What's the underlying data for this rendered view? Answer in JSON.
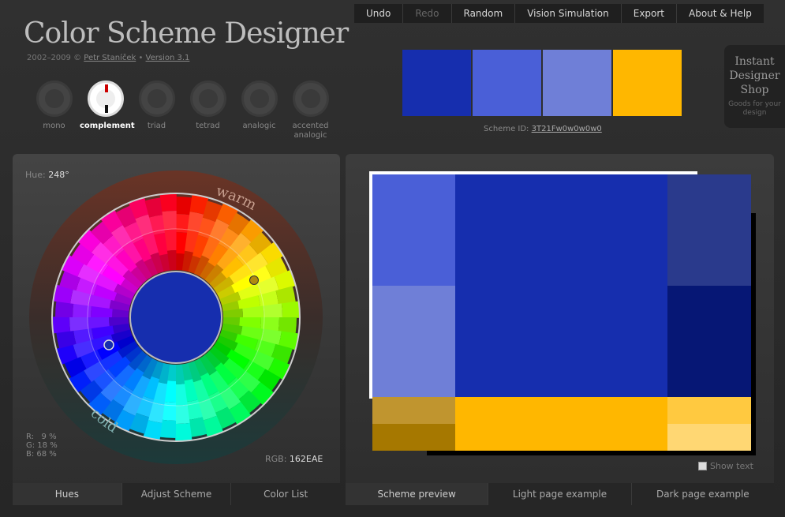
{
  "app": {
    "title": "Color Scheme Designer",
    "credits_prefix": "2002–2009 ©",
    "author": "Petr Staníček",
    "sep": "•",
    "version": "Version 3.1"
  },
  "menu": [
    "Undo",
    "Redo",
    "Random",
    "Vision Simulation",
    "Export",
    "About & Help"
  ],
  "shop": {
    "title": "Instant Designer Shop",
    "sub": "Goods for your design"
  },
  "modes": [
    {
      "label": "mono",
      "active": false
    },
    {
      "label": "complement",
      "active": true
    },
    {
      "label": "triad",
      "active": false
    },
    {
      "label": "tetrad",
      "active": false
    },
    {
      "label": "analogic",
      "active": false
    },
    {
      "label": "accented analogic",
      "active": false
    }
  ],
  "swatches": [
    "#162EAE",
    "#4A5FD7",
    "#6F7FD7",
    "#FFB700"
  ],
  "scheme_id": {
    "label": "Scheme ID:",
    "value": "3T21Fw0w0w0w0"
  },
  "hue": {
    "label": "Hue:",
    "value": "248°"
  },
  "rgb_percent": {
    "r": "R:   9 %",
    "g": "G: 18 %",
    "b": "B: 68 %"
  },
  "rgb_hex": {
    "label": "RGB:",
    "value": "162EAE"
  },
  "wheel": {
    "warm": "warm",
    "cold": "cold"
  },
  "left_tabs": [
    "Hues",
    "Adjust Scheme",
    "Color List"
  ],
  "right_tabs": [
    "Scheme preview",
    "Light page example",
    "Dark page example"
  ],
  "show_text": "Show text",
  "preview_colors": {
    "primary": "#162EAE",
    "p1": "#4A5FD7",
    "p2": "#6F7FD7",
    "p3": "#2A3A8C",
    "p4": "#061775",
    "comp": "#FFB700",
    "c1": "#C0952F",
    "c2": "#A67800",
    "c3": "#FFC940",
    "c4": "#FFD773"
  }
}
